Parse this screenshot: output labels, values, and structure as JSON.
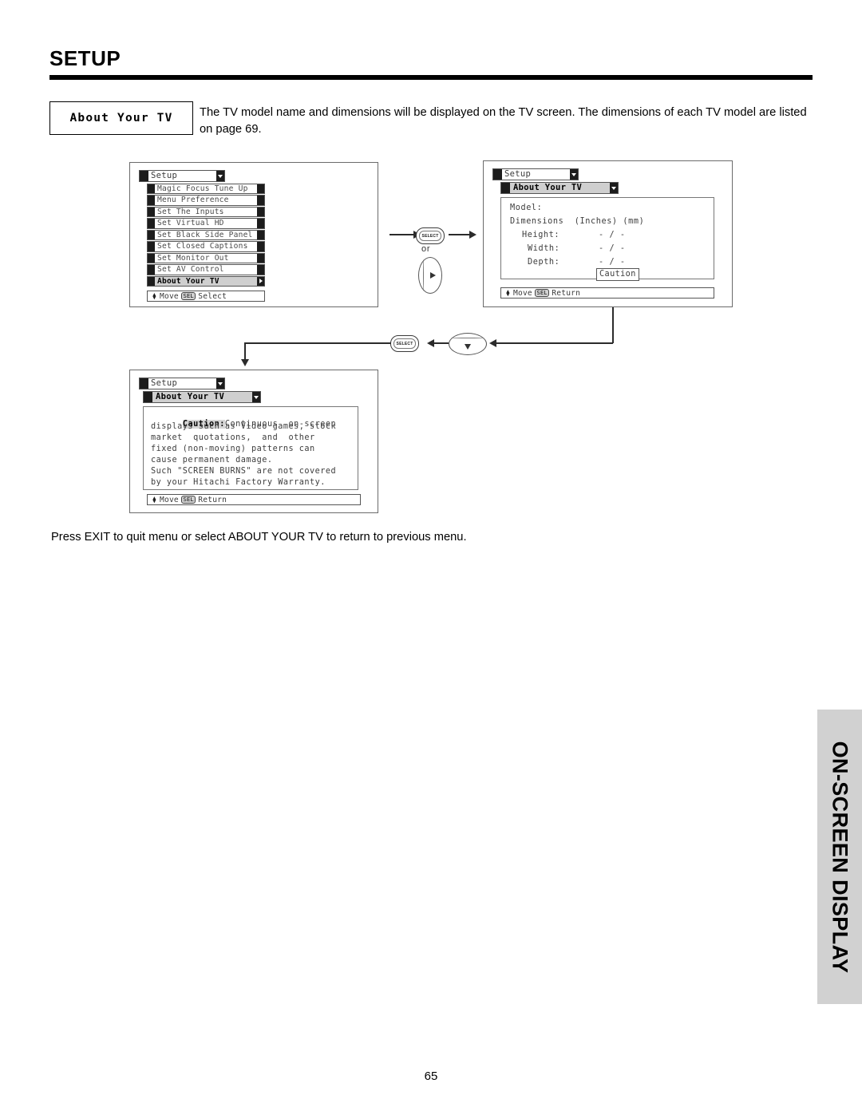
{
  "page": {
    "title": "SETUP",
    "number": "65"
  },
  "section": {
    "label": "About Your TV",
    "intro": "The TV model name and dimensions will be displayed on the TV screen.  The dimensions of each TV model are listed on page 69."
  },
  "osd1": {
    "header": "Setup",
    "items": [
      {
        "label": "Magic Focus Tune Up",
        "selected": false
      },
      {
        "label": "Menu Preference",
        "selected": false
      },
      {
        "label": "Set The Inputs",
        "selected": false
      },
      {
        "label": "Set Virtual HD",
        "selected": false
      },
      {
        "label": "Set Black Side Panel",
        "selected": false
      },
      {
        "label": "Set Closed Captions",
        "selected": false
      },
      {
        "label": "Set Monitor Out",
        "selected": false
      },
      {
        "label": "Set AV Control",
        "selected": false
      },
      {
        "label": "About Your TV",
        "selected": true
      }
    ],
    "hint_move": "Move",
    "hint_key": "SEL",
    "hint_action": "Select"
  },
  "osd2": {
    "header": "Setup",
    "subheader": "About Your TV",
    "lines": [
      "Model:",
      "Dimensions  (Inches) (mm)",
      "Height:",
      "Width:",
      "Depth:"
    ],
    "values": [
      "- / -",
      "- / -",
      "- / -"
    ],
    "caution_button": "Caution",
    "hint_move": "Move",
    "hint_key": "SEL",
    "hint_action": "Return"
  },
  "osd3": {
    "header": "Setup",
    "subheader": "About Your TV",
    "caution_word": "Caution:",
    "caution_lines": [
      "Continuous  on-screen",
      "displays such as Video games, stock",
      "market  quotations,  and  other",
      "fixed (non-moving) patterns can",
      "cause permanent damage.",
      "Such \"SCREEN BURNS\" are not covered",
      "by your Hitachi Factory Warranty."
    ],
    "hint_move": "Move",
    "hint_key": "SEL",
    "hint_action": "Return"
  },
  "flow": {
    "select_key_label": "SELECT",
    "or_label": "or",
    "right_button_name": "right-arrow-button",
    "down_button_name": "down-arrow-button"
  },
  "footer": {
    "note": "Press EXIT to quit menu or select ABOUT YOUR TV to return to previous menu."
  },
  "side_tab": {
    "text": "ON-SCREEN DISPLAY"
  }
}
